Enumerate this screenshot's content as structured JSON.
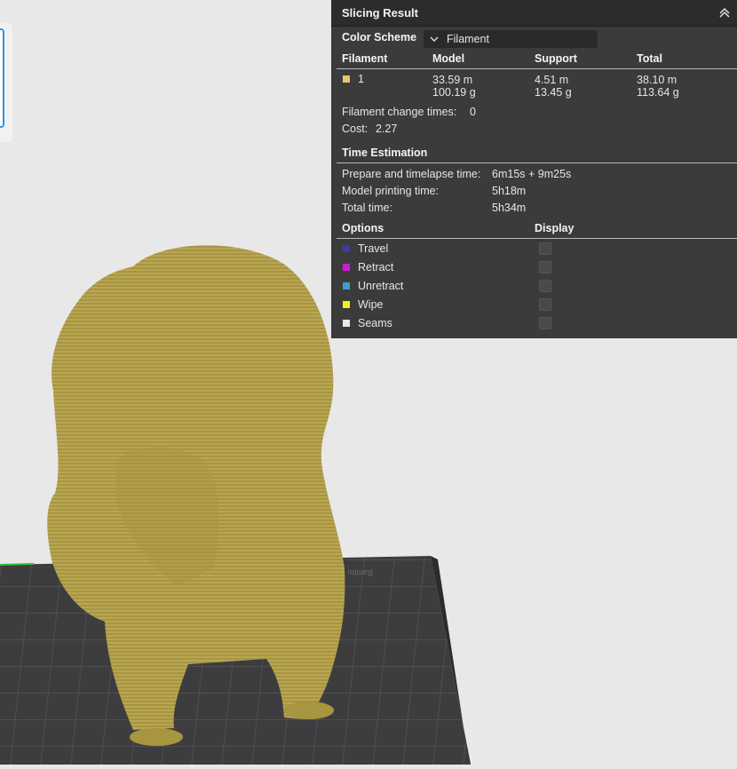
{
  "panel": {
    "title": "Slicing Result",
    "color_scheme_label": "Color Scheme",
    "color_scheme_value": "Filament",
    "filament_table": {
      "headers": [
        "Filament",
        "Model",
        "Support",
        "Total"
      ],
      "rows": [
        {
          "id": "1",
          "color": "#e8c56a",
          "model": [
            "33.59 m",
            "100.19 g"
          ],
          "support": [
            "4.51 m",
            "13.45 g"
          ],
          "total": [
            "38.10 m",
            "113.64 g"
          ]
        }
      ]
    },
    "filament_change_label": "Filament change times:",
    "filament_change_value": "0",
    "cost_label": "Cost:",
    "cost_value": "2.27",
    "time_estimation": {
      "heading": "Time Estimation",
      "prepare_label": "Prepare and timelapse time:",
      "prepare_value": "6m15s + 9m25s",
      "model_label": "Model printing time:",
      "model_value": "5h18m",
      "total_label": "Total time:",
      "total_value": "5h34m"
    },
    "options": {
      "heading": "Options",
      "display_heading": "Display",
      "items": [
        {
          "label": "Travel",
          "color": "#3a3aa8"
        },
        {
          "label": "Retract",
          "color": "#d01ad0"
        },
        {
          "label": "Unretract",
          "color": "#3aa0c8"
        },
        {
          "label": "Wipe",
          "color": "#f2f21a"
        },
        {
          "label": "Seams",
          "color": "#e8e8e8"
        }
      ]
    }
  },
  "viewport": {
    "bed_label": "Bambu",
    "model_color": "#b8a550",
    "bed_color": "#3d3d3f"
  }
}
